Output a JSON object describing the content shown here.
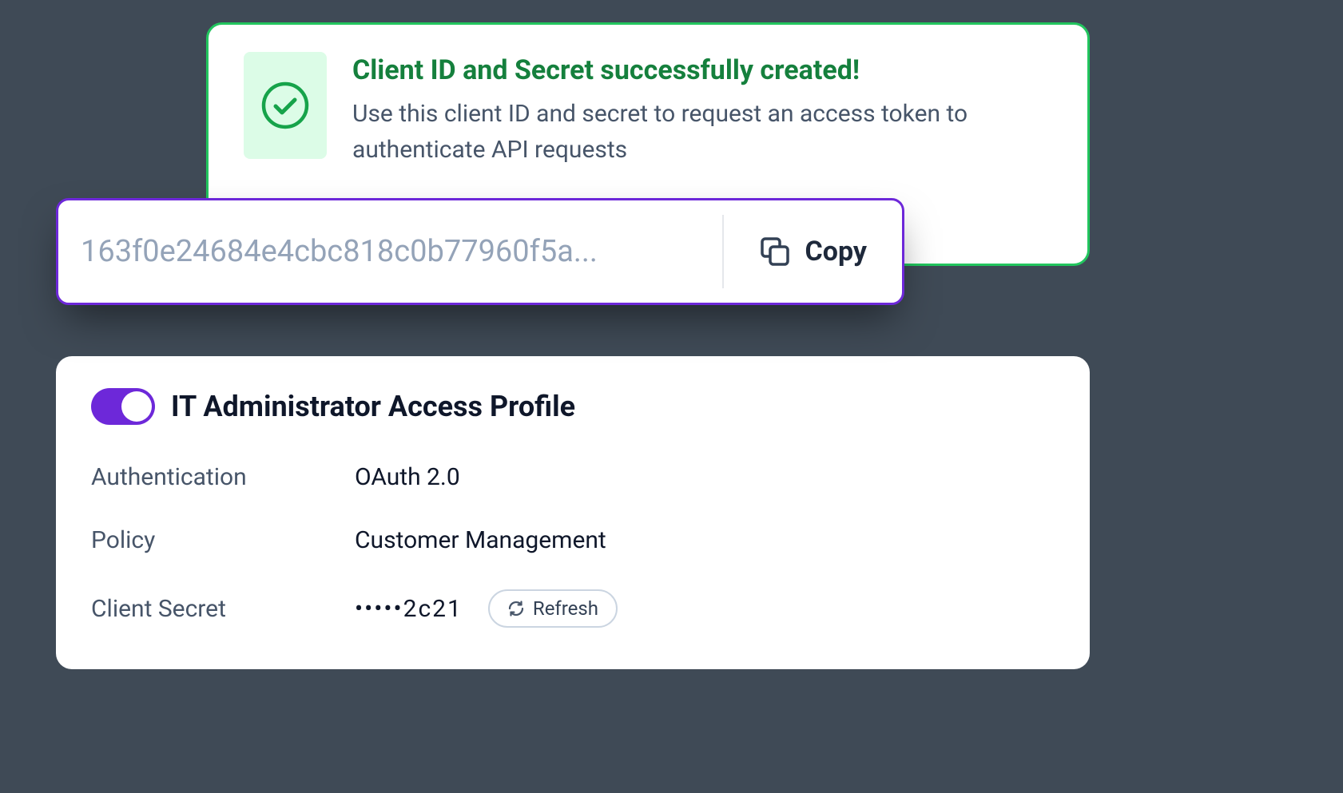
{
  "banner": {
    "title": "Client ID and Secret successfully created!",
    "subtitle": "Use this client ID and secret to request an access token to authenticate API requests"
  },
  "clientId": {
    "value": "163f0e24684e4cbc818c0b77960f5a...",
    "copyLabel": "Copy"
  },
  "profile": {
    "title": "IT Administrator Access Profile",
    "toggleOn": true,
    "rows": {
      "authentication": {
        "label": "Authentication",
        "value": "OAuth 2.0"
      },
      "policy": {
        "label": "Policy",
        "value": "Customer Management"
      },
      "clientSecret": {
        "label": "Client Secret",
        "value": "•••••2c21",
        "refreshLabel": "Refresh"
      }
    }
  }
}
